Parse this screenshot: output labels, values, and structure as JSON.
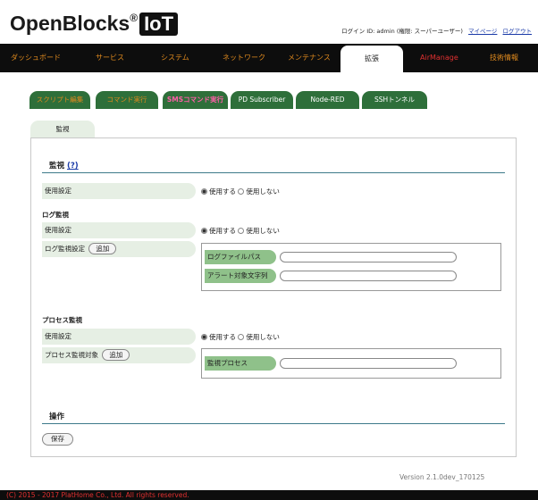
{
  "header": {
    "logo_text": "OpenBlocks",
    "logo_reg": "®",
    "logo_iot": "IoT",
    "login_text": "ログイン ID: admin (権限: スーパーユーザー)",
    "mypage_link": "マイページ",
    "logout_link": "ログアウト"
  },
  "nav": {
    "items": [
      {
        "label": "ダッシュボード"
      },
      {
        "label": "サービス"
      },
      {
        "label": "システム"
      },
      {
        "label": "ネットワーク"
      },
      {
        "label": "メンテナンス"
      },
      {
        "label": "拡張"
      },
      {
        "label": "AirManage"
      },
      {
        "label": "技術情報"
      }
    ]
  },
  "subtabs": {
    "items": [
      {
        "label": "スクリプト編集"
      },
      {
        "label": "コマンド実行"
      },
      {
        "label": "SMSコマンド実行"
      },
      {
        "label": "PD Subscriber"
      },
      {
        "label": "Node-RED"
      },
      {
        "label": "SSHトンネル"
      }
    ]
  },
  "page_tab": "監視",
  "monitor": {
    "title": "監視",
    "help": "(?)",
    "use_setting_label": "使用設定",
    "radio_use": "使用する",
    "radio_nouse": "使用しない"
  },
  "log_monitor": {
    "title": "ログ監視",
    "use_setting_label": "使用設定",
    "radio_use": "使用する",
    "radio_nouse": "使用しない",
    "setting_label": "ログ監視設定",
    "add_button": "追加",
    "logfile_path_label": "ログファイルパス",
    "logfile_path_value": "",
    "alert_string_label": "アラート対象文字列",
    "alert_string_value": ""
  },
  "process_monitor": {
    "title": "プロセス監視",
    "use_setting_label": "使用設定",
    "radio_use": "使用する",
    "radio_nouse": "使用しない",
    "target_label": "プロセス監視対象",
    "add_button": "追加",
    "process_label": "監視プロセス",
    "process_value": ""
  },
  "operation": {
    "title": "操作",
    "save_button": "保存"
  },
  "version": "Version 2.1.0dev_170125",
  "footer": "(C) 2015 - 2017 PlatHome Co., Ltd. All rights reserved.",
  "colors": {
    "nav_bg": "#0d0d0d",
    "nav_text": "#e08a1e",
    "airmanage_text": "#e03030",
    "subtab_bg": "#2e6f3a",
    "label_bg": "#e6efe4",
    "field_label_bg": "#8fc18a",
    "section_rule": "#3d7a8a"
  }
}
